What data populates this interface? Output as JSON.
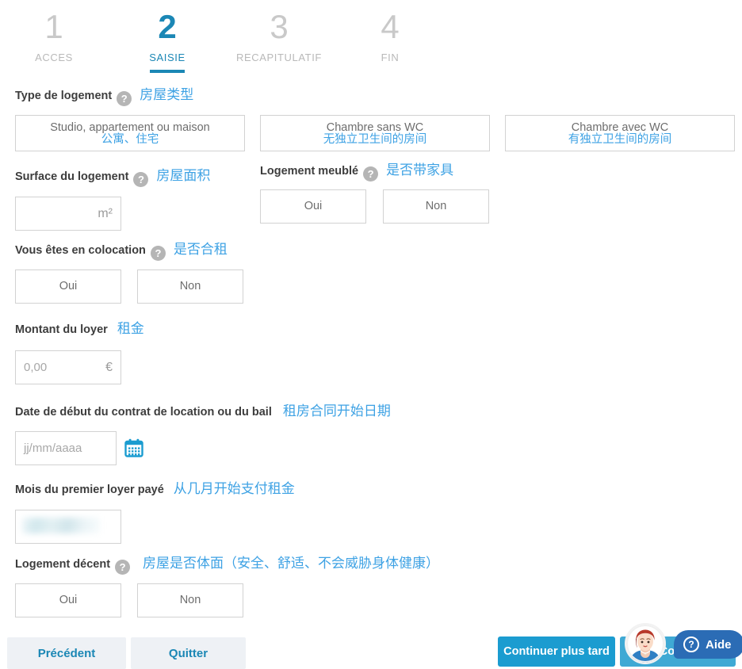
{
  "stepper": {
    "steps": [
      {
        "num": "1",
        "label": "ACCES"
      },
      {
        "num": "2",
        "label": "SAISIE"
      },
      {
        "num": "3",
        "label": "RECAPITULATIF"
      },
      {
        "num": "4",
        "label": "FIN"
      }
    ]
  },
  "colors": {
    "accent": "#1b87b5",
    "annotation": "#3ea2e4",
    "primary_button": "#1b9cd0",
    "help_widget": "#2b6cb5",
    "footer_button_bg": "#eef1f5",
    "border": "#d2d2d2",
    "inactive_step": "#c9c9c9"
  },
  "sections": {
    "housing_type": {
      "label": "Type de logement",
      "help_icon": "question-mark-icon",
      "annotation": "房屋类型",
      "options": [
        {
          "fr": "Studio, appartement ou maison",
          "zh": "公寓、住宅"
        },
        {
          "fr": "Chambre sans WC",
          "zh": "无独立卫生间的房间"
        },
        {
          "fr": "Chambre avec WC",
          "zh": "有独立卫生间的房间"
        }
      ]
    },
    "surface": {
      "label": "Surface du logement",
      "help_icon": "question-mark-icon",
      "annotation": "房屋面积",
      "value": "",
      "placeholder": "",
      "suffix": "m²"
    },
    "furnished": {
      "label": "Logement meublé",
      "help_icon": "question-mark-icon",
      "annotation": "是否带家具",
      "options": [
        "Oui",
        "Non"
      ]
    },
    "shared": {
      "label": "Vous êtes en colocation",
      "help_icon": "question-mark-icon",
      "annotation": "是否合租",
      "options": [
        "Oui",
        "Non"
      ]
    },
    "rent": {
      "label": "Montant du loyer",
      "annotation": "租金",
      "placeholder": "0,00",
      "suffix": "€"
    },
    "lease_start": {
      "label": "Date de début du contrat de location ou du bail",
      "annotation": "租房合同开始日期",
      "placeholder": "jj/mm/aaaa",
      "value": "",
      "calendar_icon": "calendar-icon"
    },
    "first_rent_month": {
      "label": "Mois du premier loyer payé",
      "annotation": "从几月开始支付租金",
      "value": "",
      "redacted": true
    },
    "decent": {
      "label": "Logement décent",
      "help_icon": "question-mark-icon",
      "annotation": "房屋是否体面（安全、舒适、不会威胁身体健康）",
      "options": [
        "Oui",
        "Non"
      ]
    }
  },
  "footer": {
    "previous": "Précédent",
    "quit": "Quitter",
    "continue_later": "Continuer plus tard",
    "continue": "Continuer"
  },
  "help_widget": {
    "label": "Aide",
    "icon": "question-mark-circle-icon",
    "avatar": "assistant-avatar"
  }
}
